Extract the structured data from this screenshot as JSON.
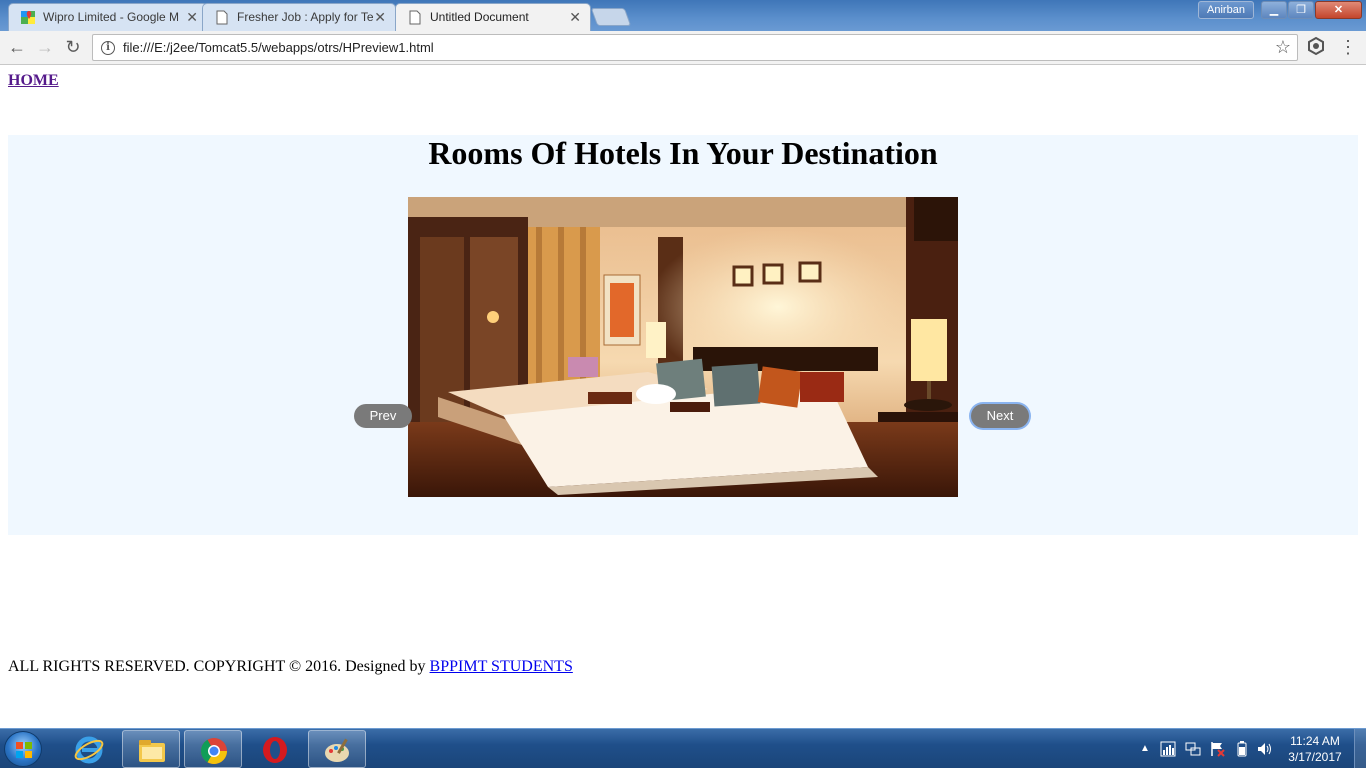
{
  "browser": {
    "tabs": [
      {
        "label": "Wipro Limited - Google M",
        "favicon": "google-maps-icon"
      },
      {
        "label": "Fresher Job : Apply for Te",
        "favicon": "document-icon"
      },
      {
        "label": "Untitled Document",
        "favicon": "document-icon"
      }
    ],
    "user_label": "Anirban",
    "url": "file:///E:/j2ee/Tomcat5.5/webapps/otrs/HPreview1.html"
  },
  "page": {
    "home_link": "HOME",
    "title": "Rooms Of Hotels In Your Destination",
    "prev_label": "Prev",
    "next_label": "Next",
    "footer_text": "ALL RIGHTS RESERVED. COPYRIGHT © 2016. Designed by ",
    "footer_link": "BPPIMT STUDENTS"
  },
  "taskbar": {
    "apps": [
      "internet-explorer-icon",
      "file-explorer-icon",
      "chrome-icon",
      "opera-icon",
      "paint-icon"
    ],
    "time": "11:24 AM",
    "date": "3/17/2017"
  },
  "colors": {
    "panel_bg": "#f0f8ff",
    "visited_link": "#551a8b",
    "link": "#0000ee",
    "slide_button": "#7a7a7a"
  }
}
